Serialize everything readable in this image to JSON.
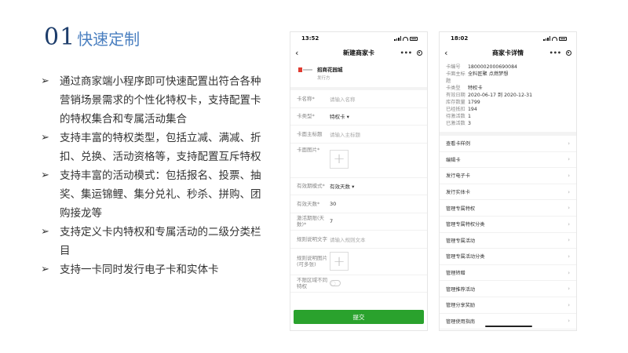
{
  "title": {
    "number": "01",
    "text": "快速定制"
  },
  "bullets": [
    "通过商家端小程序即可快速配置出符合各种营销场景需求的个性化特权卡，支持配置卡的特权集合和专属活动集合",
    "支持丰富的特权类型，包括立减、满减、折扣、兑换、活动资格等，支持配置互斥特权",
    "支持丰富的活动模式：包括报名、投票、抽奖、集运锦鲤、集分兑礼、秒杀、拼购、团购接龙等",
    "支持定义卡内特权和专属活动的二级分类栏目",
    "支持一卡同时发行电子卡和实体卡"
  ],
  "bullet_arrow": "➢",
  "phone1": {
    "time": "13:52",
    "nav_title": "新建商家卡",
    "nav_back": "‹",
    "nav_dots": "•••",
    "shop": {
      "logo_text": "招商花园城",
      "name": "招商花园城",
      "sub": "发行方"
    },
    "form": {
      "card_name": {
        "label": "卡名称*",
        "placeholder": "请输入名称"
      },
      "card_type": {
        "label": "卡类型*",
        "value": "特权卡 ▾"
      },
      "card_subtitle": {
        "label": "卡面主标题",
        "placeholder": "请输入主标题"
      },
      "card_image": {
        "label": "卡面图片*"
      },
      "validity_mode": {
        "label": "有效期模式*",
        "value": "有效天数 ▾"
      },
      "valid_days": {
        "label": "有效天数*",
        "value": "30"
      },
      "activation_days": {
        "label": "激活期限(天数)*",
        "value": "7"
      },
      "rule_text": {
        "label": "规则说明文字",
        "placeholder": "请输入规则文本"
      },
      "rule_image": {
        "label": "规则说明图片(可多张)"
      },
      "no_distinct": {
        "label": "不限区域不同特权"
      }
    },
    "submit_label": "提交"
  },
  "phone2": {
    "time": "18:02",
    "nav_title": "商家卡详情",
    "nav_back": "‹",
    "nav_dots": "•••",
    "info": [
      {
        "k": "卡编号",
        "v": "1800002000690084"
      },
      {
        "k": "卡面主标题",
        "v": "全料匠聚 点燃梦想"
      },
      {
        "k": "卡类型",
        "v": "特权卡"
      },
      {
        "k": "有效日期",
        "v": "2020-06-17 到 2020-12-31"
      },
      {
        "k": "库存数量",
        "v": "1799"
      },
      {
        "k": "已经抵扣",
        "v": "194"
      },
      {
        "k": "待激活数",
        "v": "1"
      },
      {
        "k": "已激活数",
        "v": "3"
      }
    ],
    "menu": [
      "查看卡样例",
      "编辑卡",
      "发行电子卡",
      "发行实体卡",
      "管理专属特权",
      "管理专属特权分类",
      "管理专属活动",
      "管理专属活动分类",
      "管理转赠",
      "管理推荐活动",
      "管理分享奖励",
      "管理使用指南"
    ],
    "chevron": "›"
  },
  "colors": {
    "title_number": "#1d3d6b",
    "title_text": "#4a7fc0",
    "submit": "#2aa22d"
  }
}
